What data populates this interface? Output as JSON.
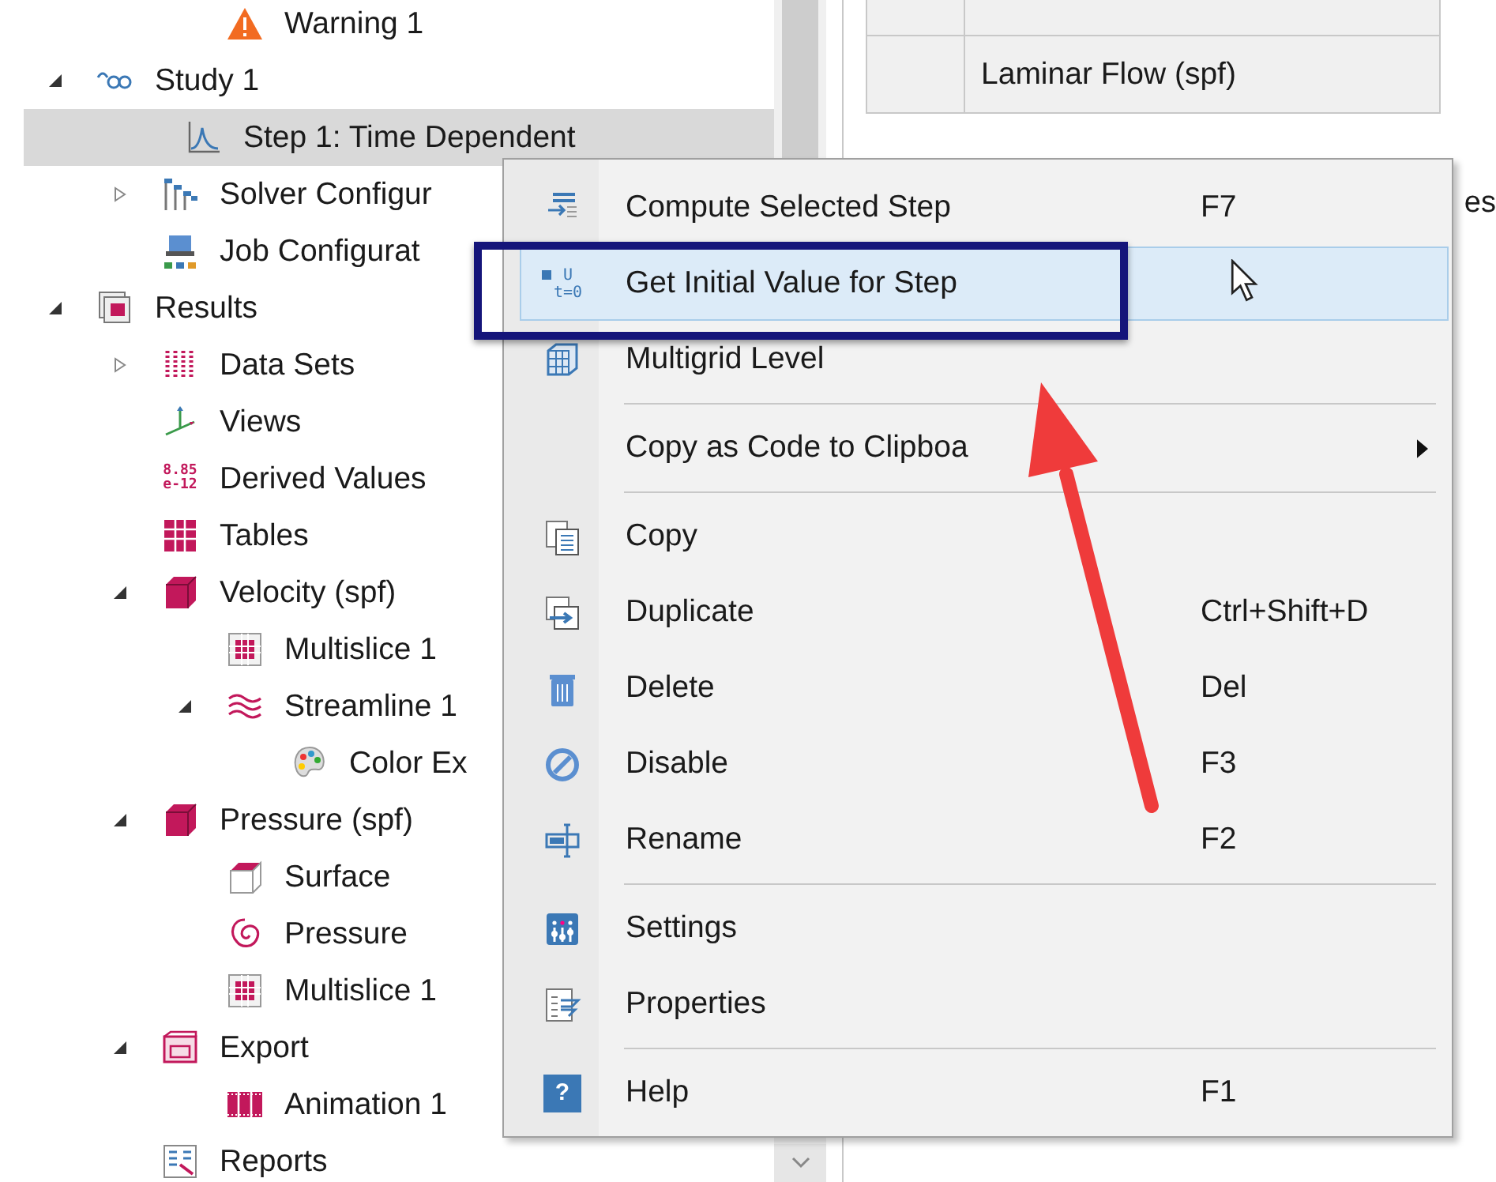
{
  "tree": {
    "clipped_above": [
      {
        "label": "Warning 1",
        "kind": "warning",
        "selected": false
      }
    ],
    "items": [
      {
        "label": "Study 1",
        "kind": "study",
        "expanded": true,
        "selected": false,
        "children": [
          {
            "label": "Step 1: Time Dependent",
            "kind": "time-step",
            "selected": true
          },
          {
            "label": "Solver Configur",
            "kind": "solver",
            "expanded": false,
            "selected": false
          },
          {
            "label": "Job Configurat",
            "kind": "job",
            "selected": false
          }
        ]
      },
      {
        "label": "Results",
        "kind": "results",
        "expanded": true,
        "selected": false,
        "children": [
          {
            "label": "Data Sets",
            "kind": "datasets",
            "expanded": false,
            "selected": false
          },
          {
            "label": "Views",
            "kind": "views",
            "selected": false
          },
          {
            "label": "Derived Values",
            "kind": "derived",
            "icon_text": [
              "8.85",
              "e-12"
            ],
            "selected": false
          },
          {
            "label": "Tables",
            "kind": "tables",
            "selected": false
          },
          {
            "label": "Velocity (spf)",
            "kind": "plot3d",
            "expanded": true,
            "selected": false,
            "children": [
              {
                "label": "Multislice 1",
                "kind": "multislice",
                "selected": false
              },
              {
                "label": "Streamline 1",
                "kind": "streamline",
                "expanded": true,
                "selected": false,
                "children": [
                  {
                    "label": "Color Ex",
                    "kind": "color",
                    "selected": false
                  }
                ]
              }
            ]
          },
          {
            "label": "Pressure (spf)",
            "kind": "plot3d",
            "expanded": true,
            "selected": false,
            "children": [
              {
                "label": "Surface",
                "kind": "surface",
                "selected": false
              },
              {
                "label": "Pressure",
                "kind": "pressure",
                "selected": false
              },
              {
                "label": "Multislice 1",
                "kind": "multislice",
                "selected": false
              }
            ]
          },
          {
            "label": "Export",
            "kind": "export",
            "expanded": true,
            "selected": false,
            "children": [
              {
                "label": "Animation 1",
                "kind": "animation",
                "selected": false
              }
            ]
          },
          {
            "label": "Reports",
            "kind": "reports",
            "selected": false
          }
        ]
      }
    ]
  },
  "table": {
    "rows": [
      {
        "cells": [
          "",
          ""
        ]
      },
      {
        "cells": [
          "",
          "Laminar Flow (spf)"
        ]
      }
    ]
  },
  "right_panel_fragment": "es",
  "context_menu": [
    {
      "kind": "compute",
      "label": "Compute Selected Step",
      "shortcut": "F7",
      "selected": false
    },
    {
      "kind": "initial-value",
      "label": "Get Initial Value for Step",
      "icon_text": [
        "U",
        "t=0"
      ],
      "selected": true
    },
    {
      "kind": "multigrid",
      "label": "Multigrid Level",
      "selected": false
    },
    {
      "kind": "separator"
    },
    {
      "kind": "plain",
      "label": "Copy as Code to Clipboa",
      "submenu": true,
      "selected": false
    },
    {
      "kind": "separator"
    },
    {
      "kind": "copy",
      "label": "Copy",
      "selected": false
    },
    {
      "kind": "duplicate",
      "label": "Duplicate",
      "shortcut": "Ctrl+Shift+D",
      "selected": false
    },
    {
      "kind": "delete",
      "label": "Delete",
      "shortcut": "Del",
      "selected": false
    },
    {
      "kind": "disable",
      "label": "Disable",
      "shortcut": "F3",
      "selected": false
    },
    {
      "kind": "rename",
      "label": "Rename",
      "shortcut": "F2",
      "selected": false
    },
    {
      "kind": "separator"
    },
    {
      "kind": "settings",
      "label": "Settings",
      "selected": false
    },
    {
      "kind": "properties",
      "label": "Properties",
      "selected": false
    },
    {
      "kind": "separator"
    },
    {
      "kind": "help",
      "label": "Help",
      "shortcut": "F1",
      "icon_text": [
        "?"
      ],
      "selected": false
    }
  ]
}
